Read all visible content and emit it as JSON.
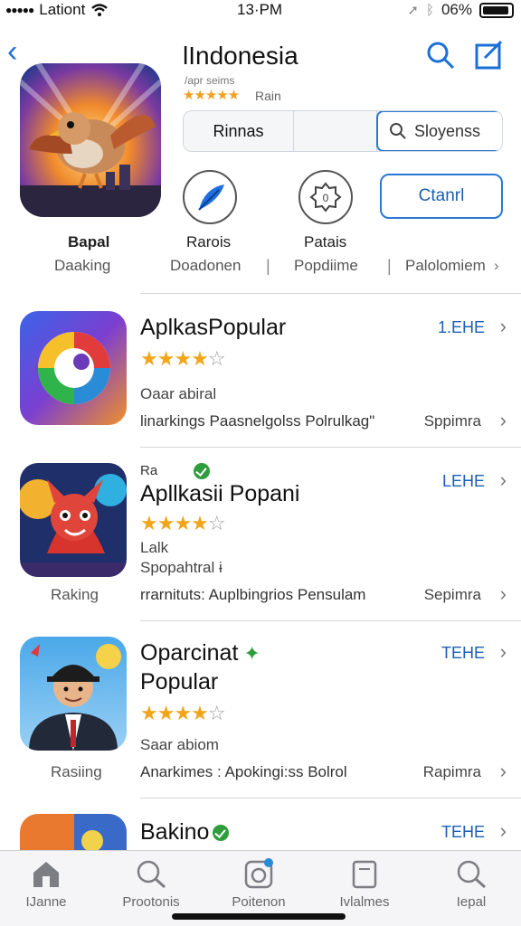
{
  "status_bar": {
    "carrier": "Lationt",
    "time": "13·PM",
    "battery": "06%"
  },
  "header": {
    "title": "lIndonesia",
    "subtitle": "/apr seims",
    "rating_label": "Rain",
    "segment": {
      "first": "Rinnas",
      "search_placeholder": "Sloyenss"
    },
    "open_button": "Ctanrl",
    "hero_label": "Bapal",
    "hero_row2": "Daaking",
    "action1_label": "Rarois",
    "action1_sub": "Doadonen",
    "action2_label": "Patais",
    "action2_sub": "Popdiime",
    "action3_sub": "Palolomiem"
  },
  "rows": [
    {
      "title": "AplkasPopular",
      "desc": "Oaar abiral",
      "meta": "linarkings Paasnelgolss Polrulkag\"",
      "pill": "1.EHE",
      "sub_right": "Sppimra",
      "rating": 4
    },
    {
      "tag": "Ra",
      "title": "Apllkasii Popani",
      "desc_1": "Lalk",
      "desc_2": "Spopahtral ɨ",
      "meta": "rrarnituts: Auplbingrios Pensulam",
      "rank_label": "Raking",
      "pill": "LEHE",
      "sub_right": "Sepimra",
      "rating": 4
    },
    {
      "title_1": "Oparcinat",
      "title_2": "Popular",
      "desc": "Saar abiom",
      "meta": "Anarkimes : Apokingi:ss Bolrol",
      "rank_label": "Rasiing",
      "pill": "TEHE",
      "sub_right": "Rapimra",
      "rating": 4
    },
    {
      "title": "Bakino",
      "pill": "TEHE"
    }
  ],
  "tabs": [
    {
      "label": "IJanne",
      "icon": "home-icon"
    },
    {
      "label": "Prootonis",
      "icon": "search-icon"
    },
    {
      "label": "Poitenon",
      "icon": "apps-icon"
    },
    {
      "label": "Ivlalmes",
      "icon": "tablet-icon"
    },
    {
      "label": "Iepal",
      "icon": "search-icon"
    }
  ],
  "colors": {
    "accent": "#1b6fd6",
    "star": "#f2a51a",
    "verified": "#2e9e3c"
  }
}
